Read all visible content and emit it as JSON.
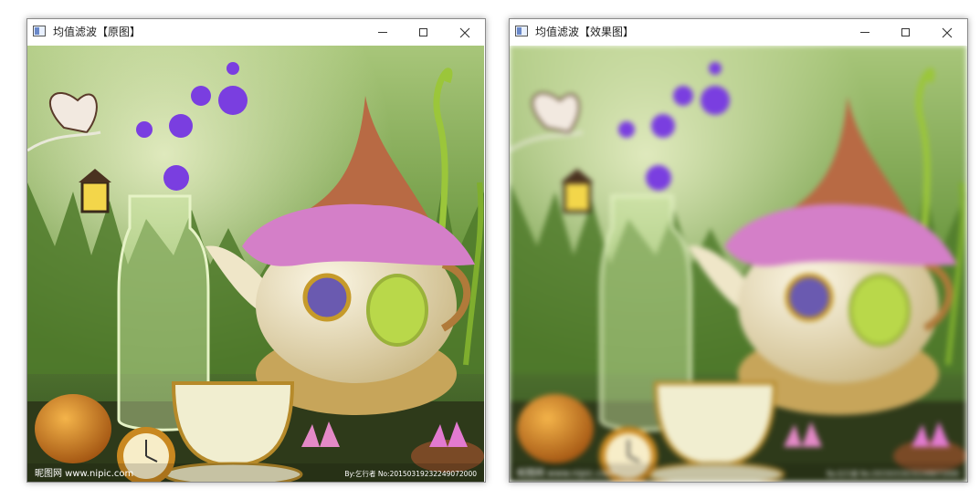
{
  "windows": [
    {
      "title": "均值滤波【原图】",
      "watermark_left": "昵图网 www.nipic.com",
      "watermark_right": "By:乞行者 No:20150319232249072000"
    },
    {
      "title": "均值滤波【效果图】",
      "watermark_left": "昵图网 www.nipic.com",
      "watermark_right": "By:乞行者 No:20150319232249072000"
    }
  ],
  "controls": {
    "minimize": "—",
    "maximize": "☐",
    "close": "✕"
  }
}
